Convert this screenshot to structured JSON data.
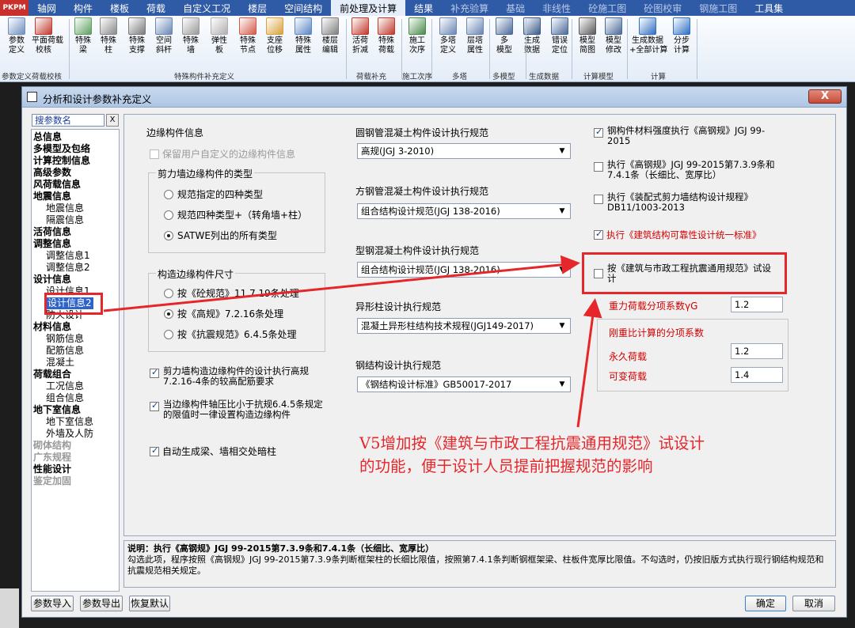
{
  "menubar": {
    "logo": "PKPM",
    "tabs": [
      {
        "label": "轴网",
        "active": false,
        "dim": false
      },
      {
        "label": "构件",
        "active": false,
        "dim": false
      },
      {
        "label": "楼板",
        "active": false,
        "dim": false
      },
      {
        "label": "荷载",
        "active": false,
        "dim": false
      },
      {
        "label": "自定义工况",
        "active": false,
        "dim": false
      },
      {
        "label": "楼层",
        "active": false,
        "dim": false
      },
      {
        "label": "空间结构",
        "active": false,
        "dim": false
      },
      {
        "label": "前处理及计算",
        "active": true,
        "dim": false
      },
      {
        "label": "结果",
        "active": false,
        "dim": false
      },
      {
        "label": "补充验算",
        "active": false,
        "dim": true
      },
      {
        "label": "基础",
        "active": false,
        "dim": true
      },
      {
        "label": "非线性",
        "active": false,
        "dim": true
      },
      {
        "label": "砼施工图",
        "active": false,
        "dim": true
      },
      {
        "label": "砼图校审",
        "active": false,
        "dim": true
      },
      {
        "label": "钢施工图",
        "active": false,
        "dim": true
      },
      {
        "label": "工具集",
        "active": false,
        "dim": false
      }
    ]
  },
  "ribbon": {
    "buttons": [
      {
        "l1": "参数",
        "l2": "定义",
        "color": "#6f8fbf"
      },
      {
        "l1": "平面荷载",
        "l2": "校核",
        "color": "#c0392b"
      },
      {
        "l1": "特殊",
        "l2": "梁",
        "color": "#5f9f5f"
      },
      {
        "l1": "特殊",
        "l2": "柱",
        "color": "#8a8a8a"
      },
      {
        "l1": "特殊",
        "l2": "支撑",
        "color": "#7a7a7a"
      },
      {
        "l1": "空间",
        "l2": "斜杆",
        "color": "#6a86b4"
      },
      {
        "l1": "特殊",
        "l2": "墙",
        "color": "#9a9a9a"
      },
      {
        "l1": "弹性",
        "l2": "板",
        "color": "#b0b0b0"
      },
      {
        "l1": "特殊",
        "l2": "节点",
        "color": "#d35a4a"
      },
      {
        "l1": "支座",
        "l2": "位移",
        "color": "#d9a13a"
      },
      {
        "l1": "特殊",
        "l2": "属性",
        "color": "#5c86c4"
      },
      {
        "l1": "楼层",
        "l2": "编辑",
        "color": "#808080"
      },
      {
        "l1": "活荷",
        "l2": "折减",
        "color": "#c0392b"
      },
      {
        "l1": "特殊",
        "l2": "荷载",
        "color": "#c0392b"
      },
      {
        "l1": "施工",
        "l2": "次序",
        "color": "#4a8a4a"
      },
      {
        "l1": "多塔",
        "l2": "定义",
        "color": "#6a86b4"
      },
      {
        "l1": "层塔",
        "l2": "属性",
        "color": "#6a86b4"
      },
      {
        "l1": "多",
        "l2": "模型",
        "color": "#4a6a9a"
      },
      {
        "l1": "生成",
        "l2": "数据",
        "color": "#3a5a8a"
      },
      {
        "l1": "错误",
        "l2": "定位",
        "color": "#4a6a9a"
      },
      {
        "l1": "模型",
        "l2": "简图",
        "color": "#5a5a5a"
      },
      {
        "l1": "模型",
        "l2": "修改",
        "color": "#4a6a9a"
      },
      {
        "l1": "生成数据",
        "l2": "+全部计算",
        "color": "#2f6fc4"
      },
      {
        "l1": "分步",
        "l2": "计算",
        "color": "#2f6fc4"
      }
    ],
    "groups": [
      "参数定义",
      "荷载校核",
      "特殊构件补充定义",
      "荷载补充",
      "施工次序",
      "多塔",
      "多模型",
      "生成数据",
      "计算模型",
      "计算"
    ]
  },
  "dialog": {
    "title": "分析和设计参数补充定义",
    "close_label": "X",
    "search_placeholder": "搜参数名",
    "search_clear": "X",
    "tree": [
      {
        "label": "总信息",
        "level": 0,
        "state": "normal"
      },
      {
        "label": "多模型及包络",
        "level": 0,
        "state": "normal"
      },
      {
        "label": "计算控制信息",
        "level": 0,
        "state": "normal"
      },
      {
        "label": "高级参数",
        "level": 0,
        "state": "normal"
      },
      {
        "label": "风荷载信息",
        "level": 0,
        "state": "normal"
      },
      {
        "label": "地震信息",
        "level": 0,
        "state": "normal"
      },
      {
        "label": "地震信息",
        "level": 1,
        "state": "normal"
      },
      {
        "label": "隔震信息",
        "level": 1,
        "state": "normal"
      },
      {
        "label": "活荷信息",
        "level": 0,
        "state": "normal"
      },
      {
        "label": "调整信息",
        "level": 0,
        "state": "normal"
      },
      {
        "label": "调整信息1",
        "level": 1,
        "state": "normal"
      },
      {
        "label": "调整信息2",
        "level": 1,
        "state": "normal"
      },
      {
        "label": "设计信息",
        "level": 0,
        "state": "normal"
      },
      {
        "label": "设计信息1",
        "level": 1,
        "state": "normal"
      },
      {
        "label": "设计信息2",
        "level": 1,
        "state": "selected"
      },
      {
        "label": "防火设计",
        "level": 1,
        "state": "normal"
      },
      {
        "label": "材料信息",
        "level": 0,
        "state": "normal"
      },
      {
        "label": "钢筋信息",
        "level": 1,
        "state": "normal"
      },
      {
        "label": "配筋信息",
        "level": 1,
        "state": "normal"
      },
      {
        "label": "混凝土",
        "level": 1,
        "state": "normal"
      },
      {
        "label": "荷载组合",
        "level": 0,
        "state": "normal"
      },
      {
        "label": "工况信息",
        "level": 1,
        "state": "normal"
      },
      {
        "label": "组合信息",
        "level": 1,
        "state": "normal"
      },
      {
        "label": "地下室信息",
        "level": 0,
        "state": "normal"
      },
      {
        "label": "地下室信息",
        "level": 1,
        "state": "normal"
      },
      {
        "label": "外墙及人防",
        "level": 1,
        "state": "normal"
      },
      {
        "label": "砌体结构",
        "level": 0,
        "state": "disabled"
      },
      {
        "label": "广东规程",
        "level": 0,
        "state": "disabled"
      },
      {
        "label": "性能设计",
        "level": 0,
        "state": "normal"
      },
      {
        "label": "鉴定加固",
        "level": 0,
        "state": "disabled"
      }
    ],
    "edge": {
      "title": "边缘构件信息",
      "keep_custom": "保留用户自定义的边缘构件信息",
      "shear_wall_type_title": "剪力墙边缘构件的类型",
      "type_options": [
        "规范指定的四种类型",
        "规范四种类型+（转角墙+柱）",
        "SATWE列出的所有类型"
      ],
      "type_selected": 2,
      "size_title": "构造边缘构件尺寸",
      "size_options": [
        "按《砼规范》11.7.19条处理",
        "按《高规》7.2.16条处理",
        "按《抗震规范》6.4.5条处理"
      ],
      "size_selected": 1,
      "check1": "剪力墙构造边缘构件的设计执行高规7.2.16-4条的较高配筋要求",
      "check2": "当边缘构件轴压比小于抗规6.4.5条规定的限值时一律设置构造边缘构件",
      "check3": "自动生成梁、墙相交处暗柱"
    },
    "codes": {
      "round_tube_title": "圆钢管混凝土构件设计执行规范",
      "round_tube_value": "高规(JGJ 3-2010)",
      "square_tube_title": "方钢管混凝土构件设计执行规范",
      "square_tube_value": "组合结构设计规范(JGJ 138-2016)",
      "steel_concrete_title": "型钢混凝土构件设计执行规范",
      "steel_concrete_value": "组合结构设计规范(JGJ 138-2016)",
      "special_column_title": "异形柱设计执行规范",
      "special_column_value": "混凝土异形柱结构技术规程(JGJ149-2017)",
      "steel_title": "钢结构设计执行规范",
      "steel_value": "《钢结构设计标准》GB50017-2017"
    },
    "right": {
      "opt1": "钢构件材料强度执行《高钢规》JGJ 99-2015",
      "opt2": "执行《高钢规》JGJ 99-2015第7.3.9条和7.4.1条（长细比、宽厚比）",
      "opt3": "执行《装配式剪力墙结构设计规程》DB11/1003-2013",
      "opt4": "执行《建筑结构可靠性设计统一标准》",
      "opt5": "按《建筑与市政工程抗震通用规范》试设计",
      "gravity_label": "重力荷载分项系数γG",
      "gravity_value": "1.2",
      "stiffness_title": "刚重比计算的分项系数",
      "permanent_label": "永久荷载",
      "permanent_value": "1.2",
      "variable_label": "可变荷载",
      "variable_value": "1.4"
    },
    "description": {
      "title": "说明：执行《高钢规》JGJ 99-2015第7.3.9条和7.4.1条（长细比、宽厚比）",
      "body": "勾选此项，程序按照《高钢规》JGJ 99-2015第7.3.9条判断框架柱的长细比限值，按照第7.4.1条判断钢框架梁、柱板件宽厚比限值。不勾选时，仍按旧版方式执行现行钢结构规范和抗震规范相关规定。"
    },
    "buttons": {
      "import": "参数导入",
      "export": "参数导出",
      "restore": "恢复默认",
      "ok": "确定",
      "cancel": "取消"
    }
  },
  "annotation": {
    "line1": "V5增加按《建筑与市政工程抗震通用规范》试设计",
    "line2": "的功能，便于设计人员提前把握规范的影响",
    "color": "#e5262b"
  }
}
